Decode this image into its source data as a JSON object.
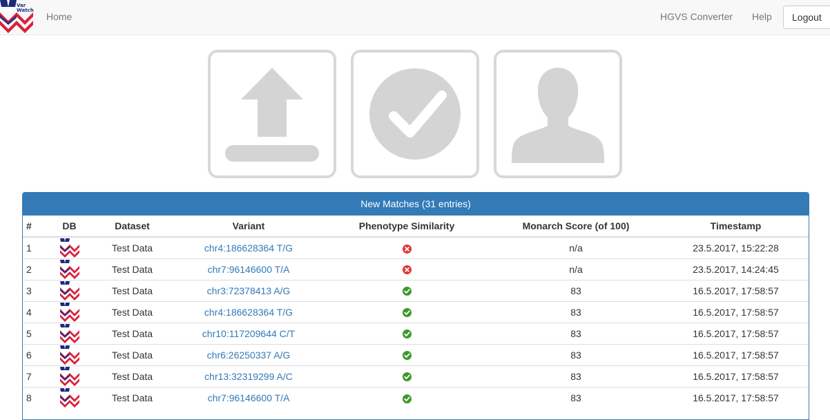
{
  "brand": {
    "logo_text_line1": "Var",
    "logo_text_line2": "Watch"
  },
  "nav": {
    "home": "Home",
    "hgvs_converter": "HGVS Converter",
    "help": "Help",
    "logout": "Logout"
  },
  "tiles": [
    {
      "icon": "upload-icon"
    },
    {
      "icon": "check-circle-icon"
    },
    {
      "icon": "user-profile-icon"
    }
  ],
  "colors": {
    "panel_primary": "#337ab7",
    "tile_gray": "#d8d8d8",
    "status_ok": "#3c9a2c",
    "status_fail": "#e3342f",
    "logo_blue": "#1d2a7a",
    "logo_red": "#d9223a"
  },
  "matches": {
    "title": "New Matches (31 entries)",
    "columns": [
      "#",
      "DB",
      "Dataset",
      "Variant",
      "Phenotype Similarity",
      "Monarch Score (of 100)",
      "Timestamp"
    ],
    "rows": [
      {
        "num": "1",
        "db": "varwatch-logo",
        "dataset": "Test Data",
        "variant": "chr4:186628364 T/G",
        "phenotype": "fail",
        "score": "n/a",
        "timestamp": "23.5.2017, 15:22:28"
      },
      {
        "num": "2",
        "db": "varwatch-logo",
        "dataset": "Test Data",
        "variant": "chr7:96146600 T/A",
        "phenotype": "fail",
        "score": "n/a",
        "timestamp": "23.5.2017, 14:24:45"
      },
      {
        "num": "3",
        "db": "varwatch-logo",
        "dataset": "Test Data",
        "variant": "chr3:72378413 A/G",
        "phenotype": "ok",
        "score": "83",
        "timestamp": "16.5.2017, 17:58:57"
      },
      {
        "num": "4",
        "db": "varwatch-logo",
        "dataset": "Test Data",
        "variant": "chr4:186628364 T/G",
        "phenotype": "ok",
        "score": "83",
        "timestamp": "16.5.2017, 17:58:57"
      },
      {
        "num": "5",
        "db": "varwatch-logo",
        "dataset": "Test Data",
        "variant": "chr10:117209644 C/T",
        "phenotype": "ok",
        "score": "83",
        "timestamp": "16.5.2017, 17:58:57"
      },
      {
        "num": "6",
        "db": "varwatch-logo",
        "dataset": "Test Data",
        "variant": "chr6:26250337 A/G",
        "phenotype": "ok",
        "score": "83",
        "timestamp": "16.5.2017, 17:58:57"
      },
      {
        "num": "7",
        "db": "varwatch-logo",
        "dataset": "Test Data",
        "variant": "chr13:32319299 A/C",
        "phenotype": "ok",
        "score": "83",
        "timestamp": "16.5.2017, 17:58:57"
      },
      {
        "num": "8",
        "db": "varwatch-logo",
        "dataset": "Test Data",
        "variant": "chr7:96146600 T/A",
        "phenotype": "ok",
        "score": "83",
        "timestamp": "16.5.2017, 17:58:57"
      }
    ]
  }
}
